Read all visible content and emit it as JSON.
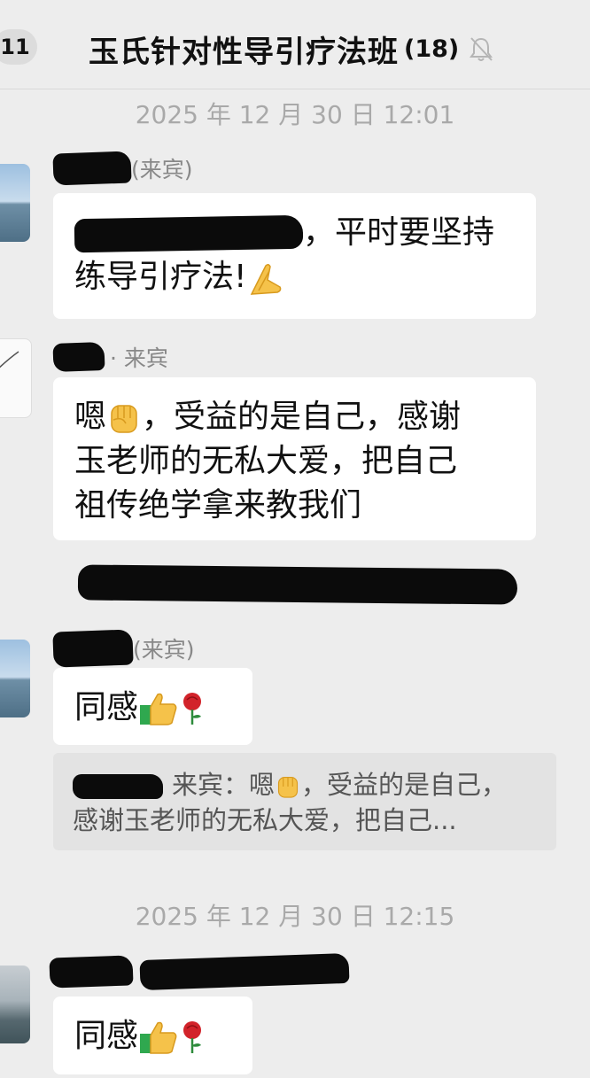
{
  "header": {
    "back_count": "11",
    "title": "玉氏针对性导引疗法班",
    "member_count": "(18)",
    "mute_icon": "bell-muted-icon"
  },
  "messages": {
    "timestamp_1": "2025 年 12 月 30 日  12:01",
    "msg1": {
      "sender_suffix": "(来宾)",
      "line1_after": "，平时要坚持",
      "line2": "练导引疗法!",
      "emoji": "folded-hands-emoji"
    },
    "msg2": {
      "sender_suffix": "· 来宾",
      "text_part1": "嗯",
      "text_part2": "，受益的是自己，感谢\n玉老师的无私大爱，把自己\n祖传绝学拿来教我们",
      "emoji": "raised-fist-emoji"
    },
    "msg3": {
      "sender_suffix": "(来宾)",
      "text": "同感",
      "emoji_1": "thumbs-up-emoji",
      "emoji_2": "rose-emoji",
      "quote_part1": "来宾：嗯",
      "quote_part2": "，受益的是自己，",
      "quote_line2": "感谢玉老师的无私大爱，把自己..."
    },
    "timestamp_2": "2025 年 12 月 30 日  12:15",
    "msg4": {
      "text": "同感",
      "emoji_1": "thumbs-up-emoji",
      "emoji_2": "rose-emoji"
    }
  }
}
